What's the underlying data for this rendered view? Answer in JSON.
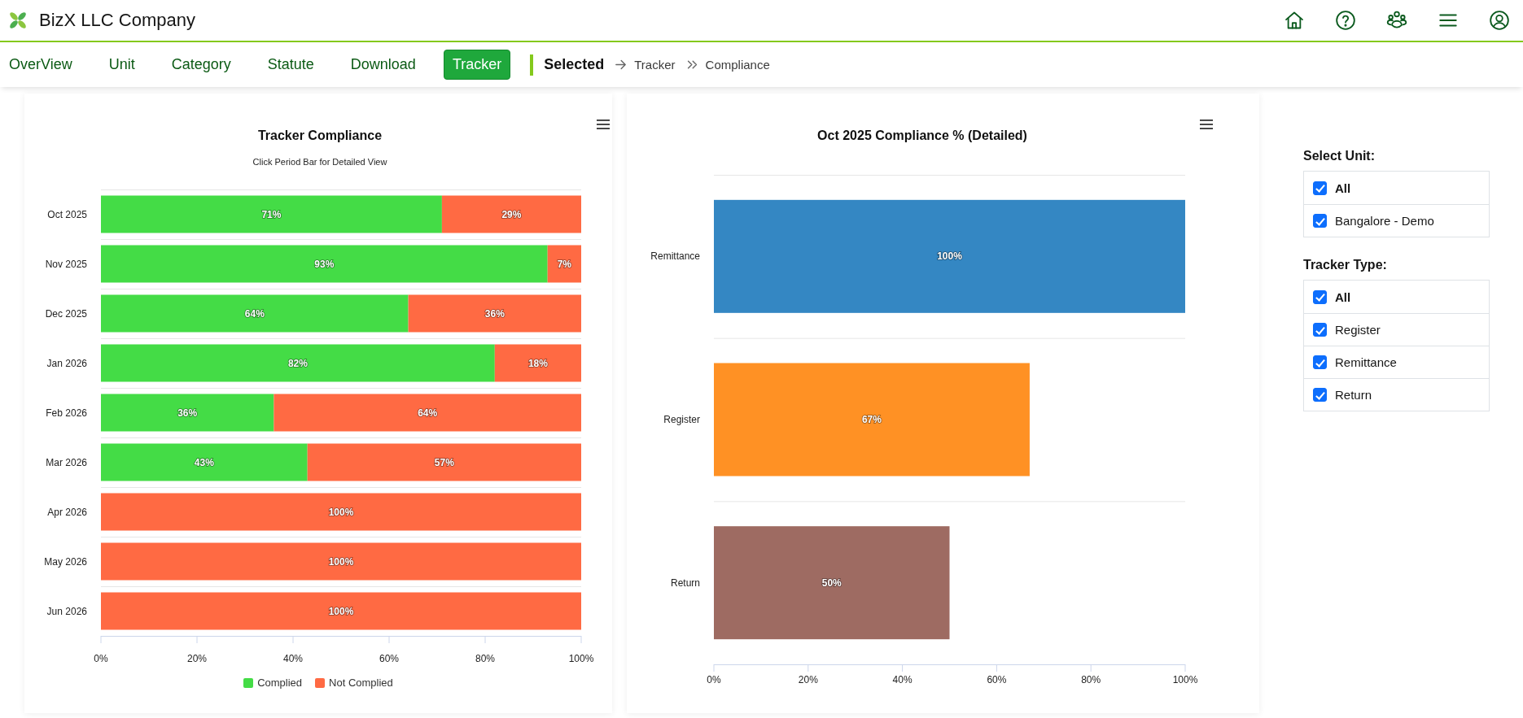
{
  "header": {
    "title": "BizX LLC Company"
  },
  "nav": {
    "tabs": [
      {
        "label": "OverView",
        "selected": false
      },
      {
        "label": "Unit",
        "selected": false
      },
      {
        "label": "Category",
        "selected": false
      },
      {
        "label": "Statute",
        "selected": false
      },
      {
        "label": "Download",
        "selected": false
      },
      {
        "label": "Tracker",
        "selected": true
      }
    ],
    "breadcrumb": {
      "label": "Selected",
      "items": [
        "Tracker",
        "Compliance"
      ]
    }
  },
  "charts": [
    {
      "subtitle": "Click Period Bar for Detailed View",
      "chart_data": {
        "type": "bar",
        "orientation": "horizontal",
        "stacked": true,
        "title": "Tracker Compliance",
        "categories": [
          "Oct 2025",
          "Nov 2025",
          "Dec 2025",
          "Jan 2026",
          "Feb 2026",
          "Mar 2026",
          "Apr 2026",
          "May 2026",
          "Jun 2026"
        ],
        "series": [
          {
            "name": "Complied",
            "color": "#44dc46",
            "values": [
              71,
              93,
              64,
              82,
              36,
              43,
              0,
              0,
              0
            ]
          },
          {
            "name": "Not Complied",
            "color": "#ff6a43",
            "values": [
              29,
              7,
              36,
              18,
              64,
              57,
              100,
              100,
              100
            ]
          }
        ],
        "xlim": [
          0,
          100
        ],
        "xticks": [
          {
            "value": 0,
            "label": "0%"
          },
          {
            "value": 20,
            "label": "20%"
          },
          {
            "value": 40,
            "label": "40%"
          },
          {
            "value": 60,
            "label": "60%"
          },
          {
            "value": 80,
            "label": "80%"
          },
          {
            "value": 100,
            "label": "100%"
          }
        ],
        "value_labels": [
          [
            "71%",
            "93%",
            "64%",
            "82%",
            "36%",
            "43%",
            null,
            null,
            null
          ],
          [
            "29%",
            "7%",
            "36%",
            "18%",
            "64%",
            "57%",
            "100%",
            "100%",
            "100%"
          ]
        ],
        "legend": "bottom"
      }
    },
    {
      "chart_data": {
        "type": "bar",
        "orientation": "horizontal",
        "title": "Oct 2025 Compliance % (Detailed)",
        "categories": [
          "Remittance",
          "Register",
          "Return"
        ],
        "values": [
          100,
          67,
          50
        ],
        "colors": [
          "#3487c3",
          "#ff9124",
          "#9e6b62"
        ],
        "xlim": [
          0,
          100
        ],
        "xticks": [
          {
            "value": 0,
            "label": "0%"
          },
          {
            "value": 20,
            "label": "20%"
          },
          {
            "value": 40,
            "label": "40%"
          },
          {
            "value": 60,
            "label": "60%"
          },
          {
            "value": 80,
            "label": "80%"
          },
          {
            "value": 100,
            "label": "100%"
          }
        ],
        "value_labels": [
          "100%",
          "67%",
          "50%"
        ]
      }
    }
  ],
  "filters": [
    {
      "title": "Select Unit:",
      "items": [
        {
          "label": "All",
          "kind": "all",
          "checked": true
        },
        {
          "label": "Bangalore - Demo",
          "kind": "option",
          "checked": true
        }
      ]
    },
    {
      "title": "Tracker Type:",
      "items": [
        {
          "label": "All",
          "kind": "all",
          "checked": true
        },
        {
          "label": "Register",
          "kind": "option",
          "checked": true
        },
        {
          "label": "Remittance",
          "kind": "option",
          "checked": true
        },
        {
          "label": "Return",
          "kind": "option",
          "checked": true
        }
      ]
    }
  ]
}
